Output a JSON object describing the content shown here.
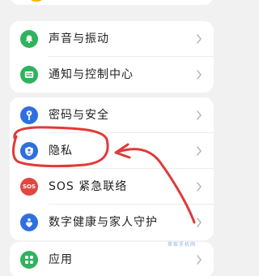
{
  "colors": {
    "background": "#f1f1f1",
    "card": "#ffffff",
    "sound_icon": "#2eb35f",
    "notification_icon": "#2eb35f",
    "security_icon": "#2f6fe0",
    "privacy_icon": "#2f6fe0",
    "sos_icon": "#e0473f",
    "wellbeing_icon": "#2f6fe0",
    "apps_icon": "#2eb35f",
    "annotation": "#e03a3a"
  },
  "groups": [
    {
      "items": [
        {
          "label": "声音与振动",
          "icon": "bell-icon"
        },
        {
          "label": "通知与控制中心",
          "icon": "notification-panel-icon"
        }
      ]
    },
    {
      "items": [
        {
          "label": "密码与安全",
          "icon": "key-icon"
        },
        {
          "label": "隐私",
          "icon": "privacy-shield-icon"
        },
        {
          "label": "SOS 紧急联络",
          "icon": "sos-icon",
          "badge": "SOS"
        },
        {
          "label": "数字健康与家人守护",
          "icon": "heart-hand-icon"
        }
      ]
    },
    {
      "items": [
        {
          "label": "应用",
          "icon": "apps-grid-icon"
        }
      ]
    }
  ],
  "watermark": "茶家手机网",
  "annotation": {
    "type": "circle-and-arrow",
    "target": "隐私"
  }
}
